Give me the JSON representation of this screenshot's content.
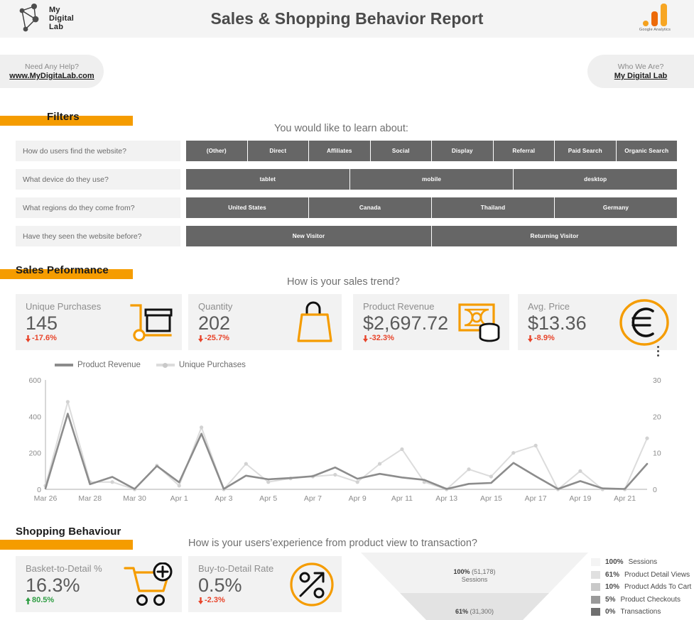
{
  "header": {
    "logo_line1": "My",
    "logo_line2": "Digital",
    "logo_line3": "Lab",
    "title": "Sales & Shopping Behavior Report",
    "analytics_label": "Google Analytics"
  },
  "contact": {
    "help_title": "Need Any Help?",
    "help_link": "www.MyDigitaLab.com",
    "who_title": "Who We Are?",
    "who_link": "My Digital Lab"
  },
  "sections": {
    "filters": {
      "title": "Filters",
      "question": "You would like to learn about:"
    },
    "sales": {
      "title": "Sales Peformance",
      "question": "How is your sales trend?"
    },
    "shopping": {
      "title": "Shopping Behaviour",
      "question": "How is your users’experience from product view to transaction?"
    }
  },
  "filters": [
    {
      "label": "How do users find the website?",
      "options": [
        "(Other)",
        "Direct",
        "Affiliates",
        "Social",
        "Display",
        "Referral",
        "Paid Search",
        "Organic Search"
      ],
      "weights": [
        1,
        1,
        1,
        1,
        1,
        1,
        1,
        1
      ]
    },
    {
      "label": "What device do they use?",
      "options": [
        "tablet",
        "mobile",
        "desktop"
      ],
      "weights": [
        1,
        1,
        1
      ]
    },
    {
      "label": "What regions do they come from?",
      "options": [
        "United States",
        "Canada",
        "Thailand",
        "Germany"
      ],
      "weights": [
        1,
        1,
        1,
        1
      ]
    },
    {
      "label": "Have they seen the website before?",
      "options": [
        "New Visitor",
        "Returning Visitor"
      ],
      "weights": [
        1,
        1
      ]
    }
  ],
  "sales_kpis": [
    {
      "title": "Unique Purchases",
      "value": "145",
      "delta": "-17.6%",
      "direction": "down",
      "icon": "trolley-box-icon"
    },
    {
      "title": "Quantity",
      "value": "202",
      "delta": "-25.7%",
      "direction": "down",
      "icon": "shopping-bag-icon"
    },
    {
      "title": "Product Revenue",
      "value": "$2,697.72",
      "delta": "-32.3%",
      "direction": "down",
      "icon": "banknote-coins-icon"
    },
    {
      "title": "Avg. Price",
      "value": "$13.36",
      "delta": "-8.9%",
      "direction": "down",
      "icon": "euro-circle-icon"
    }
  ],
  "shopping_kpis": [
    {
      "title": "Basket-to-Detail %",
      "value": "16.3%",
      "delta": "80.5%",
      "direction": "up",
      "icon": "cart-plus-icon"
    },
    {
      "title": "Buy-to-Detail Rate",
      "value": "0.5%",
      "delta": "-2.3%",
      "direction": "down",
      "icon": "percent-arrow-icon"
    }
  ],
  "colors": {
    "accent": "#f59c00",
    "filter_chip": "#666666",
    "down": "#e8442a",
    "up": "#2f9e44",
    "series_revenue": "#8c8c8c",
    "series_purchases": "#dcdcdc"
  },
  "chart_data": {
    "type": "line",
    "title": "",
    "xlabel": "",
    "ylabel": "",
    "grid": false,
    "legend_position": "top-left",
    "x": [
      "Mar 26",
      "Mar 27",
      "Mar 28",
      "Mar 29",
      "Mar 30",
      "Mar 31",
      "Apr 1",
      "Apr 2",
      "Apr 3",
      "Apr 4",
      "Apr 5",
      "Apr 6",
      "Apr 7",
      "Apr 8",
      "Apr 9",
      "Apr 10",
      "Apr 11",
      "Apr 12",
      "Apr 13",
      "Apr 14",
      "Apr 15",
      "Apr 16",
      "Apr 17",
      "Apr 18",
      "Apr 19",
      "Apr 20",
      "Apr 21",
      "Apr 22"
    ],
    "tick_labels": [
      "Mar 26",
      "Mar 28",
      "Mar 30",
      "Apr 1",
      "Apr 3",
      "Apr 5",
      "Apr 7",
      "Apr 9",
      "Apr 11",
      "Apr 13",
      "Apr 15",
      "Apr 17",
      "Apr 19",
      "Apr 21"
    ],
    "left_axis": {
      "name": "Product Revenue",
      "ticks": [
        0,
        200,
        400,
        600
      ],
      "ylim": [
        0,
        600
      ]
    },
    "right_axis": {
      "name": "Unique Purchases",
      "ticks": [
        0,
        10,
        20,
        30
      ],
      "ylim": [
        0,
        30
      ]
    },
    "series": [
      {
        "name": "Product Revenue",
        "axis": "left",
        "color": "#8c8c8c",
        "values": [
          5,
          415,
          28,
          68,
          2,
          128,
          38,
          305,
          2,
          75,
          55,
          62,
          72,
          120,
          58,
          85,
          65,
          52,
          2,
          30,
          35,
          145,
          72,
          2,
          45,
          5,
          2,
          140
        ]
      },
      {
        "name": "Unique Purchases",
        "axis": "right",
        "color": "#dcdcdc",
        "values": [
          1,
          24,
          2,
          2,
          0,
          6.5,
          1,
          17,
          0,
          7,
          2,
          3,
          3.5,
          4,
          2,
          7,
          11,
          2,
          0,
          5.5,
          3.5,
          10,
          12,
          0,
          5,
          0,
          0,
          14
        ]
      }
    ]
  },
  "funnel": {
    "stages": [
      {
        "pct": "100%",
        "count": "(51,178)",
        "label": "Sessions",
        "color": "#f2f2f2"
      },
      {
        "pct": "61%",
        "count": "(31,300)",
        "label": "Product Detail Views",
        "color": "#e3e3e3"
      }
    ],
    "legend": [
      {
        "pct": "100%",
        "label": "Sessions",
        "color": "#f4f4f4"
      },
      {
        "pct": "61%",
        "label": "Product Detail Views",
        "color": "#e0e0e0"
      },
      {
        "pct": "10%",
        "label": "Product Adds To Cart",
        "color": "#c9c9c9"
      },
      {
        "pct": "5%",
        "label": "Product Checkouts",
        "color": "#9a9a9a"
      },
      {
        "pct": "0%",
        "label": "Transactions",
        "color": "#6f6f6f"
      }
    ]
  }
}
